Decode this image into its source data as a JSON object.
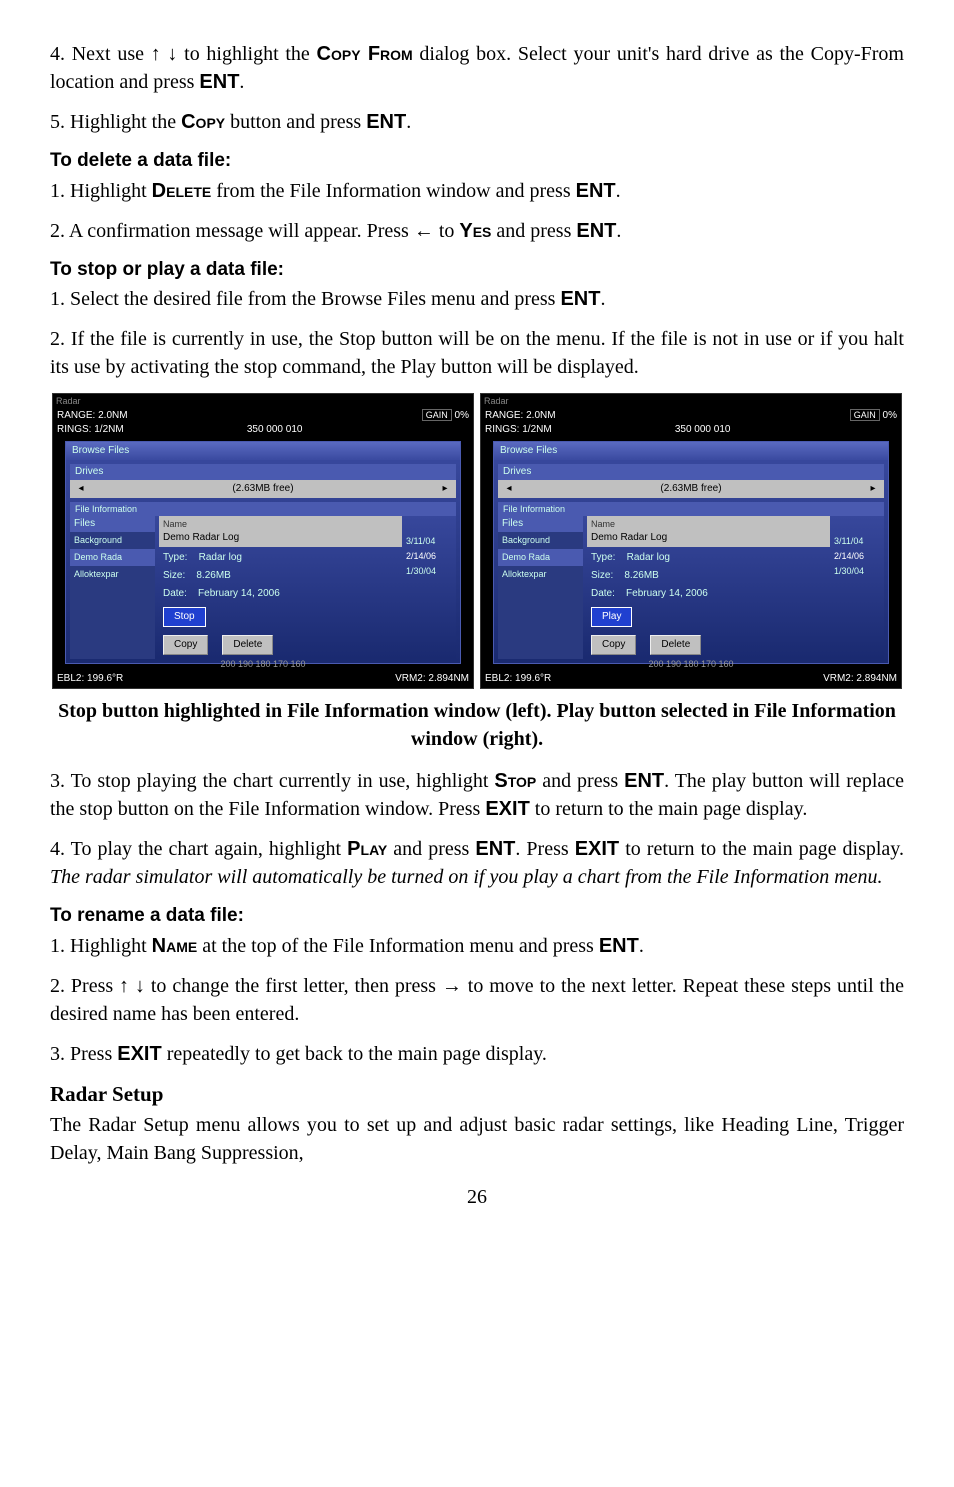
{
  "step4": {
    "prefix": "4. Next use ↑ ↓ to highlight the ",
    "copyfrom": "Copy From",
    "mid": " dialog box. Select your unit's hard drive as the Copy-From location and press ",
    "ent": "ENT",
    "suffix": "."
  },
  "step5": {
    "prefix": "5. Highlight the ",
    "copy": "Copy",
    "mid": " button and press ",
    "ent": "ENT",
    "suffix": "."
  },
  "delete_head": "To delete a data file:",
  "del1": {
    "prefix": "1. Highlight ",
    "delete": "Delete",
    "mid": " from the File Information window and press ",
    "ent": "ENT",
    "suffix": "."
  },
  "del2": {
    "prefix": "2. A confirmation message will appear. Press ← to ",
    "yes": "Yes",
    "mid": " and press ",
    "ent": "ENT",
    "suffix": "."
  },
  "stop_head": "To stop or play a data file:",
  "sp1": {
    "prefix": "1. Select the desired file from the Browse Files menu and press ",
    "ent": "ENT",
    "suffix": "."
  },
  "sp2": "2. If the file is currently in use, the Stop button will be on the menu. If the file is not in use or if you halt its use by activating the stop command, the Play button will be displayed.",
  "caption": "Stop button highlighted in File Information window (left). Play button selected in File Information window (right).",
  "sp3": {
    "prefix": "3. To stop playing the chart currently in use, highlight ",
    "stop": "Stop",
    "mid": " and press ",
    "ent": "ENT",
    "mid2": ". The play button will replace the stop button on the File Information window. Press ",
    "exit": "EXIT",
    "suffix": " to return to the main page display."
  },
  "sp4": {
    "prefix": "4. To play the chart again, highlight ",
    "play": "Play",
    "mid": " and press ",
    "ent": "ENT",
    "mid2": ". Press ",
    "exit": "EXIT",
    "mid3": " to return to the main page display. ",
    "italic": "The radar simulator will automatically be turned on if you play a chart from the File Information menu."
  },
  "rename_head": "To rename a data file:",
  "rn1": {
    "prefix": "1. Highlight ",
    "name": "Name",
    "mid": " at the top of the File Information menu and press ",
    "ent": "ENT",
    "suffix": "."
  },
  "rn2": "2. Press ↑ ↓ to change the first letter, then press → to move to the next letter. Repeat these steps until the desired name has been entered.",
  "rn3": {
    "prefix": "3. Press ",
    "exit": "EXIT",
    "suffix": " repeatedly to get back to the main page display."
  },
  "radar_head": "Radar Setup",
  "radar_body": "The Radar Setup menu allows you to set up and adjust basic radar settings, like Heading Line, Trigger Delay, Main Bang Suppression,",
  "page": "26",
  "fig": {
    "radar_label": "Radar",
    "range": "RANGE: 2.0NM",
    "rings": "RINGS: 1/2NM",
    "topticks": "350  000  010",
    "gain": "GAIN",
    "gainpct": "0%",
    "browse": "Browse Files",
    "drives": "Drives",
    "drives_free": "(2.63MB free)",
    "fileinfo": "File Information",
    "files": "Files",
    "f_background": "Background",
    "f_demo": "Demo Rada",
    "f_allok": "Alloktexpar",
    "name_label": "Name",
    "name_val": "Demo Radar Log",
    "type": "Type:",
    "type_val": "Radar log",
    "size": "Size:",
    "size_val": "8.26MB",
    "date": "Date:",
    "date_val": "February 14, 2006",
    "stop": "Stop",
    "play": "Play",
    "copy": "Copy",
    "delete": "Delete",
    "d1": "3/11/04",
    "d2": "2/14/06",
    "d3": "1/30/04",
    "ticks": "200   190  180  170   160",
    "ebl": "EBL2: 199.6°R",
    "vrm": "VRM2: 2.894NM"
  }
}
